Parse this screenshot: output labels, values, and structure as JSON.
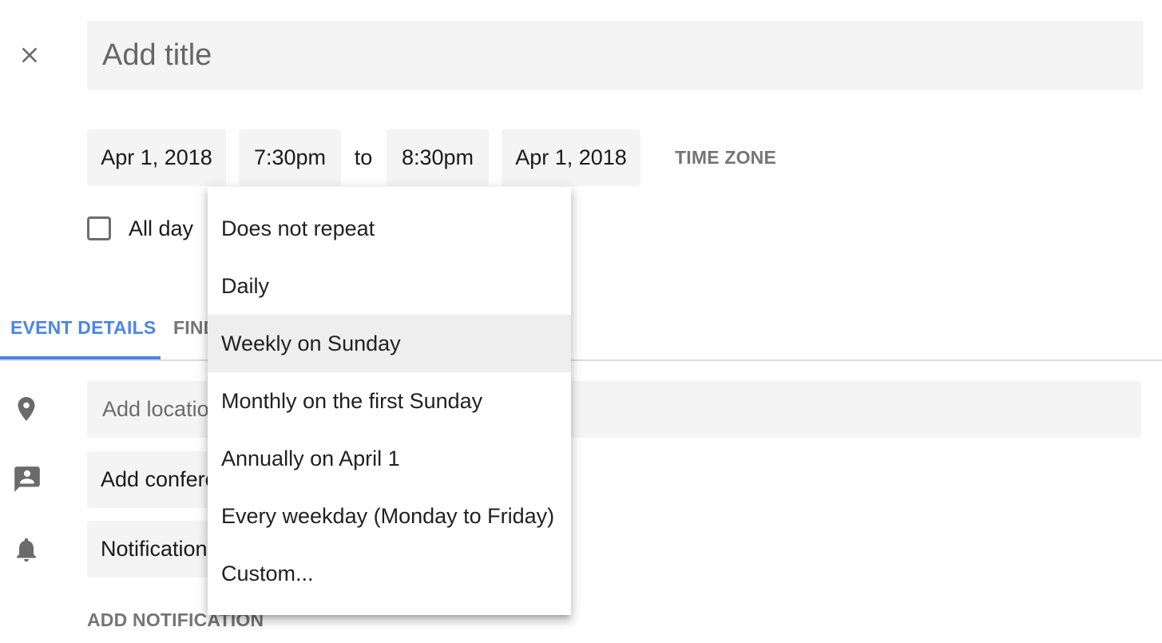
{
  "header": {
    "close_icon": "close-icon",
    "title_placeholder": "Add title",
    "title_value": ""
  },
  "datetime": {
    "start_date": "Apr 1, 2018",
    "start_time": "7:30pm",
    "separator": "to",
    "end_time": "8:30pm",
    "end_date": "Apr 1, 2018",
    "time_zone_label": "TIME ZONE"
  },
  "all_day": {
    "label": "All day",
    "checked": false
  },
  "tabs": [
    {
      "label": "EVENT DETAILS",
      "active": true
    },
    {
      "label": "FIND A TIME",
      "active": false
    }
  ],
  "details": {
    "location": {
      "icon": "location-pin-icon",
      "placeholder": "Add location",
      "value": ""
    },
    "conference": {
      "icon": "conference-icon",
      "label": "Add conferencing"
    },
    "notification": {
      "icon": "bell-icon",
      "label": "Notification"
    },
    "add_notification_label": "ADD NOTIFICATION"
  },
  "repeat_menu": {
    "items": [
      {
        "label": "Does not repeat",
        "highlighted": false
      },
      {
        "label": "Daily",
        "highlighted": false
      },
      {
        "label": "Weekly on Sunday",
        "highlighted": true
      },
      {
        "label": "Monthly on the first Sunday",
        "highlighted": false
      },
      {
        "label": "Annually on April 1",
        "highlighted": false
      },
      {
        "label": "Every weekday (Monday to Friday)",
        "highlighted": false
      },
      {
        "label": "Custom...",
        "highlighted": false
      }
    ]
  },
  "colors": {
    "accent": "#4a86e8",
    "field_bg": "#f4f4f4",
    "secondary_text": "#757575",
    "menu_highlight": "#eeeeee"
  }
}
